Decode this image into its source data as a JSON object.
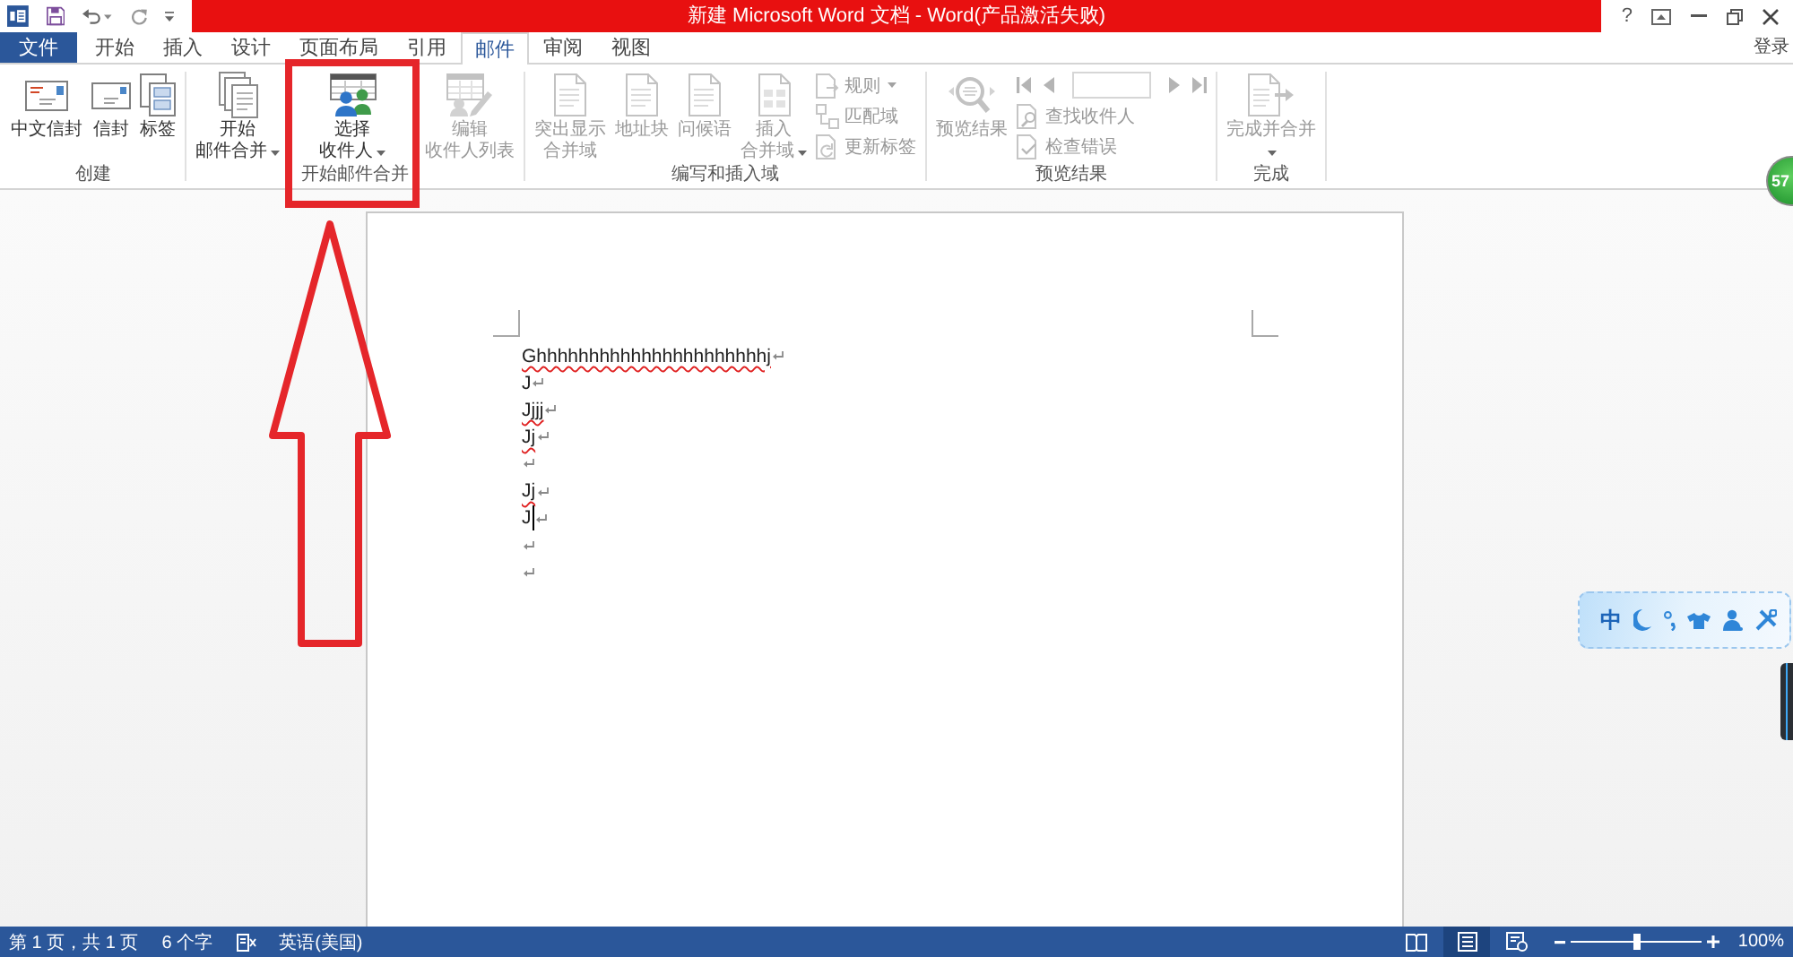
{
  "window": {
    "title": "新建 Microsoft Word 文档 - Word(产品激活失败)",
    "help": "?",
    "sign_in": "登录"
  },
  "tabs": [
    {
      "label": "文件",
      "kind": "backstage",
      "selected": false
    },
    {
      "label": "开始",
      "kind": "tab",
      "selected": false
    },
    {
      "label": "插入",
      "kind": "tab",
      "selected": false
    },
    {
      "label": "设计",
      "kind": "tab",
      "selected": false
    },
    {
      "label": "页面布局",
      "kind": "tab",
      "selected": false
    },
    {
      "label": "引用",
      "kind": "tab",
      "selected": false
    },
    {
      "label": "邮件",
      "kind": "tab",
      "selected": true
    },
    {
      "label": "审阅",
      "kind": "tab",
      "selected": false
    },
    {
      "label": "视图",
      "kind": "tab",
      "selected": false
    }
  ],
  "ribbon": {
    "groups": [
      {
        "label": "创建",
        "items": [
          {
            "kind": "large",
            "lines": [
              "中文信封"
            ],
            "dropdown": false,
            "disabled": false,
            "highlighted": false
          },
          {
            "kind": "large",
            "lines": [
              "信封"
            ],
            "dropdown": false,
            "disabled": false,
            "highlighted": false
          },
          {
            "kind": "large",
            "lines": [
              "标签"
            ],
            "dropdown": false,
            "disabled": false,
            "highlighted": false
          }
        ]
      },
      {
        "label": "开始邮件合并",
        "items": [
          {
            "kind": "large",
            "lines": [
              "开始",
              "邮件合并"
            ],
            "dropdown": true,
            "disabled": false,
            "highlighted": false
          },
          {
            "kind": "large",
            "lines": [
              "选择",
              "收件人"
            ],
            "dropdown": true,
            "disabled": false,
            "highlighted": true
          },
          {
            "kind": "large",
            "lines": [
              "编辑",
              "收件人列表"
            ],
            "dropdown": false,
            "disabled": true,
            "highlighted": false
          }
        ]
      },
      {
        "label": "编写和插入域",
        "items": [
          {
            "kind": "large",
            "lines": [
              "突出显示",
              "合并域"
            ],
            "dropdown": false,
            "disabled": true,
            "highlighted": false
          },
          {
            "kind": "large",
            "lines": [
              "地址块"
            ],
            "dropdown": false,
            "disabled": true,
            "highlighted": false
          },
          {
            "kind": "large",
            "lines": [
              "问候语"
            ],
            "dropdown": false,
            "disabled": true,
            "highlighted": false
          },
          {
            "kind": "large",
            "lines": [
              "插入",
              "合并域"
            ],
            "dropdown": true,
            "disabled": true,
            "highlighted": false
          },
          {
            "kind": "small",
            "label": "规则",
            "dropdown": true,
            "disabled": true
          },
          {
            "kind": "small",
            "label": "匹配域",
            "dropdown": false,
            "disabled": true
          },
          {
            "kind": "small",
            "label": "更新标签",
            "dropdown": false,
            "disabled": true
          }
        ]
      },
      {
        "label": "预览结果",
        "items": [
          {
            "kind": "large",
            "lines": [
              "预览结果"
            ],
            "dropdown": false,
            "disabled": true,
            "highlighted": false
          },
          {
            "kind": "record_nav",
            "disabled": true
          },
          {
            "kind": "small",
            "label": "查找收件人",
            "dropdown": false,
            "disabled": true
          },
          {
            "kind": "small",
            "label": "检查错误",
            "dropdown": false,
            "disabled": true
          }
        ]
      },
      {
        "label": "完成",
        "items": [
          {
            "kind": "large",
            "lines": [
              "完成并合并"
            ],
            "dropdown": true,
            "disabled": true,
            "highlighted": false
          }
        ]
      }
    ]
  },
  "document": {
    "lines": [
      {
        "kind": "text",
        "text": "Ghhhhhhhhhhhhhhhhhhhhhhj",
        "misspelled": true,
        "cursor": false
      },
      {
        "kind": "text",
        "text": "J",
        "misspelled": false,
        "cursor": false
      },
      {
        "kind": "text",
        "text": "Jjjj",
        "misspelled": true,
        "cursor": false
      },
      {
        "kind": "text",
        "text": "Jj",
        "misspelled": true,
        "cursor": false
      },
      {
        "kind": "empty",
        "cursor": false
      },
      {
        "kind": "text",
        "text": "Jj",
        "misspelled": true,
        "cursor": false
      },
      {
        "kind": "text",
        "text": "J",
        "misspelled": false,
        "cursor": true
      },
      {
        "kind": "empty",
        "cursor": false
      },
      {
        "kind": "empty",
        "cursor": false
      }
    ]
  },
  "badge": {
    "text": "57"
  },
  "ime_toolbar": {
    "mode": "中"
  },
  "status_bar": {
    "page": "第 1 页，共 1 页",
    "word_count": "6 个字",
    "language": "英语(美国)",
    "views": [
      {
        "selected": false
      },
      {
        "selected": true
      },
      {
        "selected": false
      }
    ],
    "zoom_slider": {
      "level": 0.5
    },
    "zoom": "100%"
  }
}
